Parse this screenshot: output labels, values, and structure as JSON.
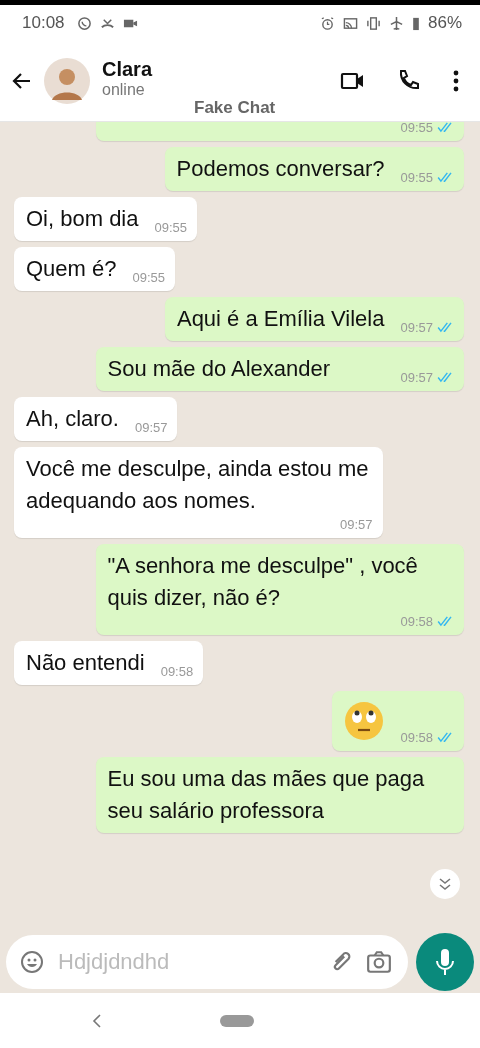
{
  "status_bar": {
    "time": "10:08",
    "battery": "86%"
  },
  "header": {
    "name": "Clara",
    "status": "online",
    "caption": "Fake Chat"
  },
  "messages": [
    {
      "kind": "text",
      "outgoing": true,
      "time": "09:55",
      "read": true
    },
    {
      "kind": "text",
      "outgoing": true,
      "text": "Podemos conversar?",
      "time": "09:55",
      "read": true
    },
    {
      "kind": "text",
      "outgoing": false,
      "text": "Oi, bom dia",
      "time": "09:55"
    },
    {
      "kind": "text",
      "outgoing": false,
      "text": "Quem é?",
      "time": "09:55"
    },
    {
      "kind": "text",
      "outgoing": true,
      "text": "Aqui é a Emília Vilela",
      "time": "09:57",
      "read": true
    },
    {
      "kind": "text",
      "outgoing": true,
      "text": "Sou mãe do Alexander",
      "time": "09:57",
      "read": true,
      "wide": true
    },
    {
      "kind": "text",
      "outgoing": false,
      "text": "Ah, claro.",
      "time": "09:57"
    },
    {
      "kind": "text",
      "outgoing": false,
      "text": "Você me desculpe, ainda estou me adequando aos nomes.",
      "time": "09:57"
    },
    {
      "kind": "text",
      "outgoing": true,
      "text": "\"A senhora me desculpe\" , você quis dizer, não é?",
      "time": "09:58",
      "read": true
    },
    {
      "kind": "text",
      "outgoing": false,
      "text": "Não entendi",
      "time": "09:58"
    },
    {
      "kind": "emoji",
      "outgoing": true,
      "time": "09:58",
      "read": true
    },
    {
      "kind": "text",
      "outgoing": true,
      "text": "Eu sou uma das mães que paga seu salário professora",
      "wide": true
    }
  ],
  "composer": {
    "placeholder": "Hdjdjdndhd"
  }
}
